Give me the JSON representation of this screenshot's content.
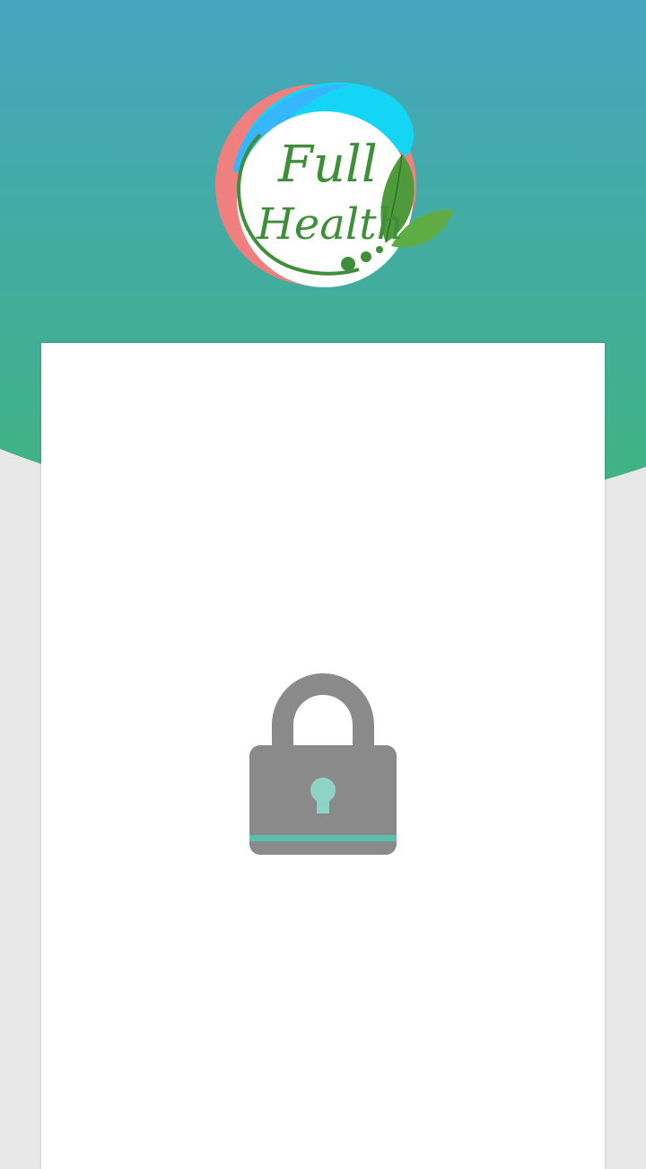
{
  "app": {
    "logo_line1": "Full",
    "logo_line2": "Health"
  },
  "colors": {
    "header_top": "#45a6c0",
    "header_bottom": "#40b37f",
    "page_bg": "#e8e8e8",
    "card_bg": "#ffffff",
    "lock_body": "#8a8a8a",
    "lock_accent": "#5cc0ae",
    "keyhole": "#8fd3c6"
  },
  "icons": {
    "logo": "full-health-logo",
    "lock": "lock-icon"
  }
}
